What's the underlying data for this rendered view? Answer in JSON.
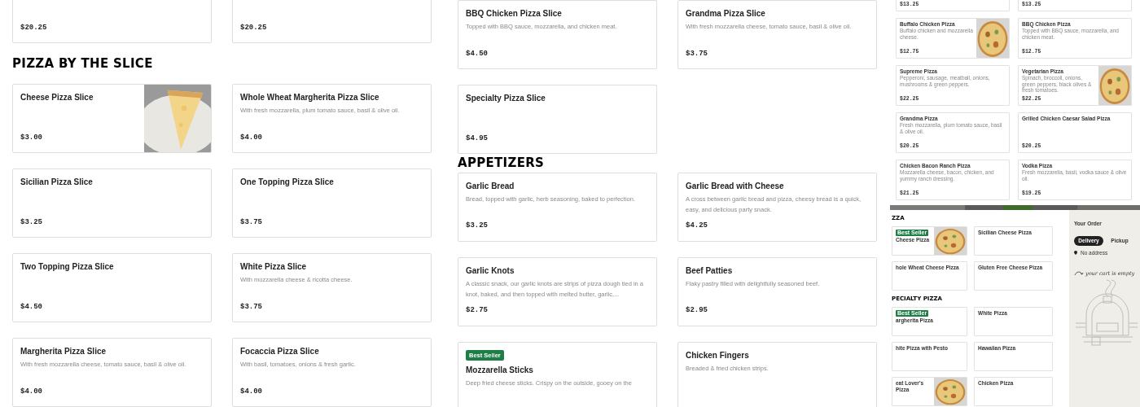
{
  "columns": [
    {
      "blocks": [
        {
          "kind": "cards",
          "items": [
            {
              "kind": "text",
              "price": "$20.25"
            },
            {
              "kind": "text",
              "price": "$20.25"
            }
          ]
        },
        {
          "kind": "heading",
          "text": "PIZZA BY THE SLICE"
        },
        {
          "kind": "cards",
          "items": [
            {
              "kind": "picture",
              "title": "Cheese Pizza Slice",
              "price": "$3.00"
            },
            {
              "kind": "text",
              "title": "Whole Wheat Margherita Pizza Slice",
              "description": "With fresh mozzarella, plum tomato sauce, basil & olive oil.",
              "price": "$4.00"
            },
            {
              "kind": "text",
              "title": "Sicilian Pizza Slice",
              "price": "$3.25"
            },
            {
              "kind": "text",
              "title": "One Topping Pizza Slice",
              "price": "$3.75"
            },
            {
              "kind": "text",
              "title": "Two Topping Pizza Slice",
              "price": "$4.50"
            },
            {
              "kind": "text",
              "title": "White Pizza Slice",
              "description": "With mozzarella cheese & ricotta cheese.",
              "price": "$3.75"
            },
            {
              "kind": "text",
              "title": "Margherita Pizza Slice",
              "description": "With fresh mozzarella cheese, tomato sauce, basil & olive oil.",
              "price": "$4.00"
            },
            {
              "kind": "text",
              "title": "Focaccia Pizza Slice",
              "description": "With basil, tomatoes, onions & fresh garlic.",
              "price": "$4.00"
            }
          ]
        }
      ]
    },
    {
      "blocks": [
        {
          "kind": "cards",
          "items": [
            {
              "kind": "text",
              "title": "BBQ Chicken Pizza Slice",
              "description": "Topped with BBQ sauce, mozzarella, and chicken meat.",
              "price": "$4.50"
            },
            {
              "kind": "text",
              "title": "Grandma Pizza Slice",
              "description": "With fresh mozzarella cheese, tomato sauce, basil & olive oil.",
              "price": "$3.75"
            },
            {
              "kind": "text",
              "title": "Specialty Pizza Slice",
              "price": "$4.95"
            }
          ]
        },
        {
          "kind": "heading",
          "text": "APPETIZERS"
        },
        {
          "kind": "cards",
          "items": [
            {
              "kind": "text",
              "title": "Garlic Bread",
              "description": "Bread, topped with garlic, herb seasoning, baked to perfection.",
              "price": "$3.25"
            },
            {
              "kind": "text",
              "title": "Garlic Bread with Cheese",
              "description": "A cross between garlic bread and pizza, cheesy bread is a quick, easy, and delicious party snack.",
              "price": "$4.25"
            },
            {
              "kind": "text",
              "title": "Garlic Knots",
              "description": "A classic snack, our garlic knots are strips of pizza dough tied in a knot, baked, and then topped with melted butter, garlic,...",
              "price": "$2.75"
            },
            {
              "kind": "text",
              "title": "Beef Patties",
              "description": "Flaky pastry filled with delightfully seasoned beef.",
              "price": "$2.95"
            },
            {
              "kind": "text",
              "badge": "Best Seller",
              "title": "Mozzarella Sticks",
              "description": "Deep fried cheese sticks. Crispy on the outside, gooey on the"
            },
            {
              "kind": "text",
              "title": "Chicken Fingers",
              "description": "Breaded & fried chicken strips."
            }
          ]
        }
      ]
    }
  ],
  "pizza_list_screenshot": {
    "items": [
      {
        "kind": "text",
        "price": "$13.25"
      },
      {
        "kind": "text",
        "price": "$13.25"
      },
      {
        "kind": "picture",
        "title": "Buffalo Chicken Pizza",
        "description": "Buffalo chicken and mozzarella cheese.",
        "price": "$12.75"
      },
      {
        "kind": "text",
        "title": "BBQ Chicken Pizza",
        "description": "Topped with BBQ sauce, mozzarella, and chicken meat.",
        "price": "$12.75"
      },
      {
        "kind": "text",
        "title": "Supreme Pizza",
        "description": "Pepperoni, sausage, meatball, onions, mushrooms & green peppers.",
        "price": "$22.25"
      },
      {
        "kind": "picture",
        "title": "Vegetarian Pizza",
        "description": "Spinach, broccoli, onions, green peppers, black olives & fresh tomatoes.",
        "price": "$22.25"
      },
      {
        "kind": "text",
        "title": "Grandma Pizza",
        "description": "Fresh mozzarella, plum tomato sauce, basil & olive oil.",
        "price": "$20.25"
      },
      {
        "kind": "text",
        "title": "Grilled Chicken Caesar Salad Pizza",
        "price": "$20.25"
      },
      {
        "kind": "text",
        "title": "Chicken Bacon Ranch Pizza",
        "description": "Mozzarella cheese, bacon, chicken, and yummy ranch dressing.",
        "price": "$21.25"
      },
      {
        "kind": "text",
        "title": "Vodka Pizza",
        "description": "Fresh mozzarella, basil, vodka sauce & olive oil.",
        "price": "$19.25"
      }
    ]
  },
  "order_screenshot": {
    "sections": [
      {
        "heading": "ZZA",
        "items": [
          {
            "kind": "picture",
            "badge": "Best Seller",
            "title": "Cheese Pizza"
          },
          {
            "kind": "text",
            "title": "Sicilian Cheese Pizza"
          },
          {
            "kind": "text",
            "title": "hole Wheat Cheese Pizza"
          },
          {
            "kind": "text",
            "title": "Gluten Free Cheese Pizza"
          }
        ]
      },
      {
        "heading": "PECIALTY PIZZA",
        "items": [
          {
            "kind": "text",
            "badge": "Best Seller",
            "title": "argherita Pizza"
          },
          {
            "kind": "text",
            "title": "White Pizza"
          },
          {
            "kind": "text",
            "title": "hite Pizza with Pesto"
          },
          {
            "kind": "text",
            "title": "Hawaiian Pizza"
          },
          {
            "kind": "picture",
            "title": "eat Lover's Pizza"
          },
          {
            "kind": "text",
            "title": "Chicken Pizza"
          }
        ]
      }
    ],
    "cart": {
      "title": "Your Order",
      "modes": [
        {
          "label": "Delivery",
          "selected": true
        },
        {
          "label": "Pickup",
          "selected": false
        }
      ],
      "address": "No address",
      "empty_message": "your cart is empty"
    }
  }
}
